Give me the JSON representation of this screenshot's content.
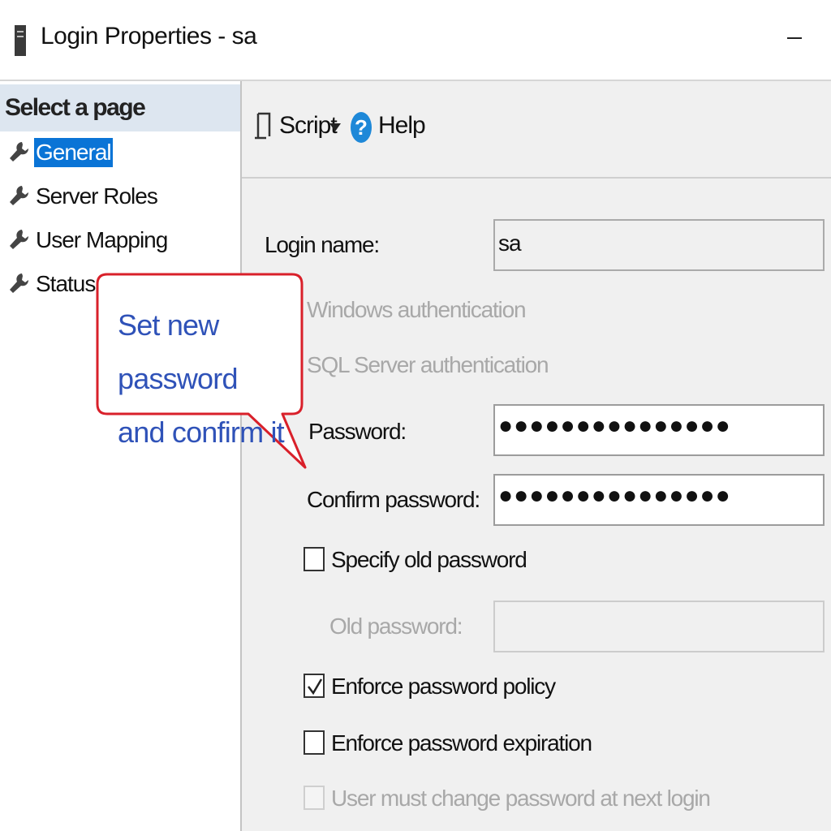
{
  "window": {
    "title": "Login Properties - sa",
    "minimize_icon": "minimize-icon"
  },
  "sidebar": {
    "header": "Select a page",
    "items": [
      {
        "label": "General",
        "selected": true,
        "icon": "wrench-icon"
      },
      {
        "label": "Server Roles",
        "selected": false,
        "icon": "wrench-icon"
      },
      {
        "label": "User Mapping",
        "selected": false,
        "icon": "wrench-icon"
      },
      {
        "label": "Status",
        "selected": false,
        "icon": "wrench-icon"
      }
    ]
  },
  "toolbar": {
    "script_label": "Script",
    "help_label": "Help"
  },
  "form": {
    "login_name_label": "Login name:",
    "login_name_value": "sa",
    "windows_auth_label": "Windows authentication",
    "sql_auth_label": "SQL Server authentication",
    "password_label": "Password:",
    "password_value": "●●●●●●●●●●●●●●●",
    "confirm_password_label": "Confirm password:",
    "confirm_password_value": "●●●●●●●●●●●●●●●",
    "specify_old_password_label": "Specify old password",
    "specify_old_password_checked": false,
    "old_password_label": "Old password:",
    "old_password_value": "",
    "enforce_policy_label": "Enforce password policy",
    "enforce_policy_checked": true,
    "enforce_expiration_label": "Enforce password expiration",
    "enforce_expiration_checked": false,
    "must_change_label": "User must change password at next login",
    "must_change_checked": false
  },
  "callout": {
    "line1": "Set new password",
    "line2": "and confirm it",
    "border_color": "#d9202a",
    "text_color": "#2f52b8"
  },
  "colors": {
    "selection": "#0a74d6",
    "sidebar_header_bg": "#dde6f0",
    "panel_bg": "#f0f0f0",
    "help_icon": "#1e88d8"
  }
}
